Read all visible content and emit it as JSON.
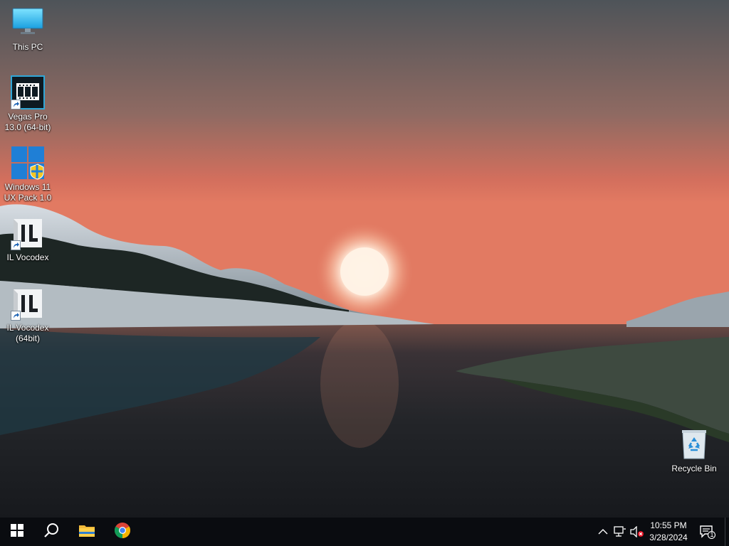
{
  "desktop": {
    "icons": [
      {
        "label": "This PC",
        "icon": "monitor-icon"
      },
      {
        "label": "Vegas Pro 13.0 (64-bit)",
        "icon": "film-icon",
        "shortcut": true
      },
      {
        "label": "Windows 11 UX Pack 1.0",
        "icon": "windows-logo-icon",
        "shortcut": false
      },
      {
        "label": "IL Vocodex",
        "icon": "il-logo-icon",
        "shortcut": true
      },
      {
        "label": "IL Vocodex (64bit)",
        "icon": "il-logo-icon",
        "shortcut": true
      },
      {
        "label": "Recycle Bin",
        "icon": "recycle-bin-icon"
      }
    ]
  },
  "taskbar": {
    "start": {
      "icon": "windows-logo-icon"
    },
    "search": {
      "icon": "search-icon"
    },
    "apps": [
      {
        "name": "File Explorer",
        "icon": "folder-icon"
      },
      {
        "name": "Google Chrome",
        "icon": "chrome-icon"
      }
    ],
    "tray": {
      "icons": [
        "chevron-up-icon",
        "network-icon",
        "volume-muted-icon"
      ],
      "time": "10:55 PM",
      "date": "3/28/2024",
      "notification_count": "1"
    }
  },
  "colors": {
    "taskbar_bg": "#0a0c10",
    "accent_blue": "#1f7fd6",
    "sunset": "#e0745f"
  }
}
